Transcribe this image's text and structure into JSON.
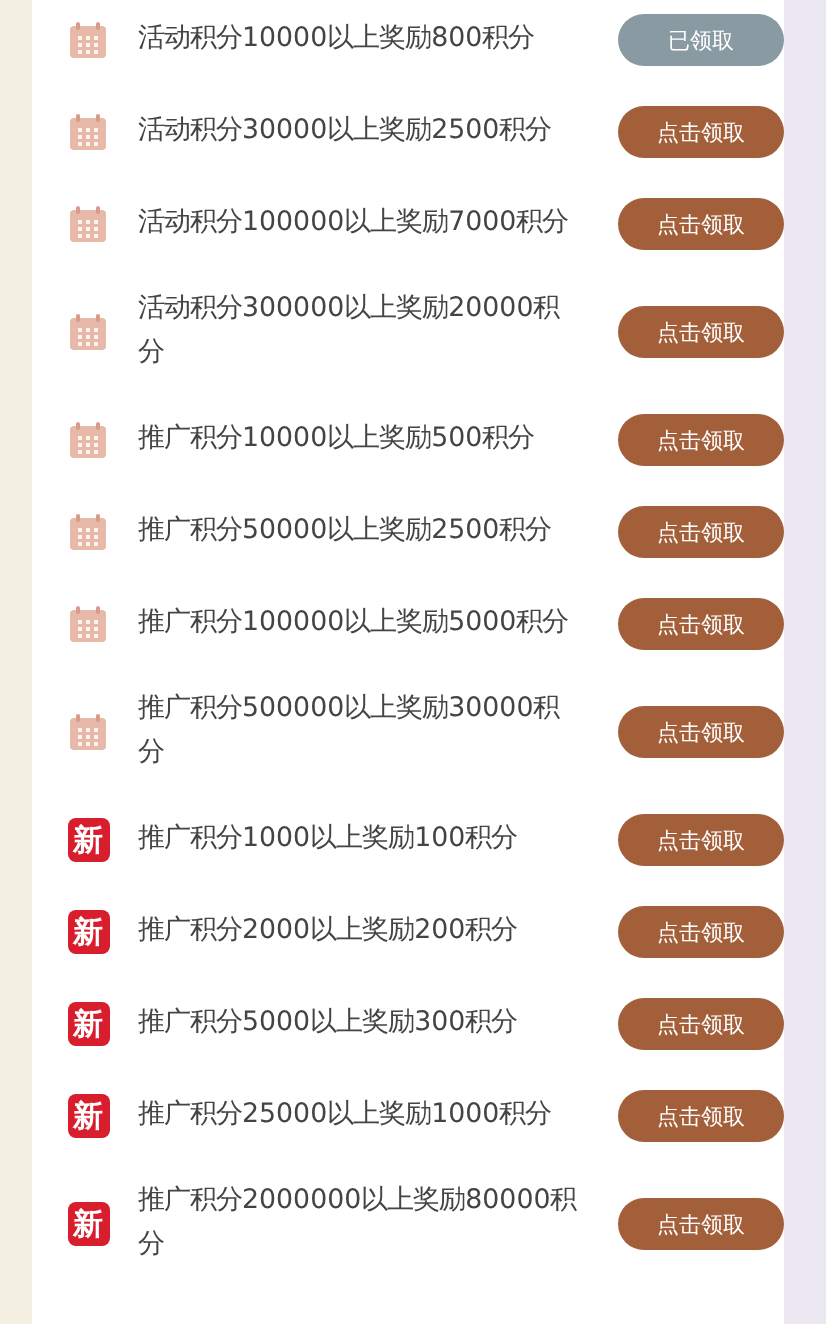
{
  "rewards": [
    {
      "kind": "calendar",
      "text": "活动积分10000以上奖励800积分",
      "button": "已领取",
      "claimed": true
    },
    {
      "kind": "calendar",
      "text": "活动积分30000以上奖励2500积分",
      "button": "点击领取",
      "claimed": false
    },
    {
      "kind": "calendar",
      "text": "活动积分100000以上奖励7000积分",
      "button": "点击领取",
      "claimed": false
    },
    {
      "kind": "calendar",
      "text": "活动积分300000以上奖励20000积分",
      "button": "点击领取",
      "claimed": false
    },
    {
      "kind": "calendar",
      "text": "推广积分10000以上奖励500积分",
      "button": "点击领取",
      "claimed": false
    },
    {
      "kind": "calendar",
      "text": "推广积分50000以上奖励2500积分",
      "button": "点击领取",
      "claimed": false
    },
    {
      "kind": "calendar",
      "text": "推广积分100000以上奖励5000积分",
      "button": "点击领取",
      "claimed": false
    },
    {
      "kind": "calendar",
      "text": "推广积分500000以上奖励30000积分",
      "button": "点击领取",
      "claimed": false
    },
    {
      "kind": "new",
      "badge": "新",
      "text": "推广积分1000以上奖励100积分",
      "button": "点击领取",
      "claimed": false
    },
    {
      "kind": "new",
      "badge": "新",
      "text": "推广积分2000以上奖励200积分",
      "button": "点击领取",
      "claimed": false
    },
    {
      "kind": "new",
      "badge": "新",
      "text": "推广积分5000以上奖励300积分",
      "button": "点击领取",
      "claimed": false
    },
    {
      "kind": "new",
      "badge": "新",
      "text": "推广积分25000以上奖励1000积分",
      "button": "点击领取",
      "claimed": false
    },
    {
      "kind": "new",
      "badge": "新",
      "text": "推广积分2000000以上奖励80000积分",
      "button": "点击领取",
      "claimed": false
    }
  ]
}
